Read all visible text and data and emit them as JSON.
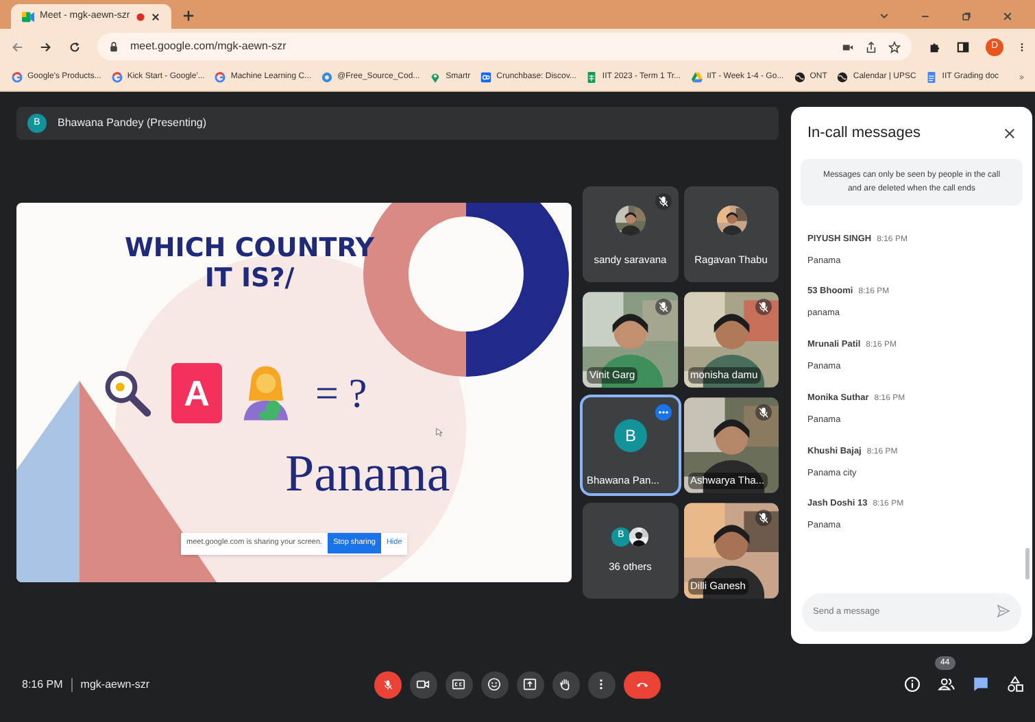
{
  "browser": {
    "tab": {
      "title": "Meet - mgk-aewn-szr",
      "recording": true
    },
    "address": "meet.google.com/mgk-aewn-szr",
    "profile_initial": "D",
    "bookmarks": [
      {
        "kind": "google",
        "label": "Google's Products..."
      },
      {
        "kind": "google",
        "label": "Kick Start - Google'..."
      },
      {
        "kind": "google",
        "label": "Machine Learning C..."
      },
      {
        "kind": "sync",
        "label": "@Free_Source_Cod..."
      },
      {
        "kind": "pin",
        "label": "Smartr"
      },
      {
        "kind": "crunchbase",
        "label": "Crunchbase: Discov..."
      },
      {
        "kind": "sheet",
        "label": "IIT 2023 - Term 1 Tr..."
      },
      {
        "kind": "drive",
        "label": "IIT - Week 1-4 - Go..."
      },
      {
        "kind": "globe",
        "label": "ONT"
      },
      {
        "kind": "globe",
        "label": "Calendar | UPSC"
      },
      {
        "kind": "doc",
        "label": "IIT Grading doc"
      }
    ]
  },
  "presenter": {
    "initial": "B",
    "label": "Bhawana Pandey (Presenting)"
  },
  "slide": {
    "title": "WHICH COUNTRY IT IS?/",
    "letter": "A",
    "equation": "= ?",
    "answer": "Panama",
    "share_bar": {
      "message": "meet.google.com is sharing your screen.",
      "button": "Stop sharing",
      "link": "Hide"
    }
  },
  "tiles": [
    {
      "kind": "avatar",
      "name": "sandy saravana",
      "muted": true,
      "highlighted": false
    },
    {
      "kind": "avatar",
      "name": "Ragavan Thabu",
      "muted": false,
      "highlighted": false
    },
    {
      "kind": "video",
      "name": "Vinit Garg",
      "muted": true,
      "highlighted": false
    },
    {
      "kind": "video",
      "name": "monisha damu",
      "muted": true,
      "highlighted": false
    },
    {
      "kind": "initial",
      "name": "Bhawana Pan...",
      "initial": "B",
      "muted": false,
      "highlighted": true
    },
    {
      "kind": "video",
      "name": "Ashwarya Tha...",
      "muted": true,
      "highlighted": false
    },
    {
      "kind": "others",
      "name": "36 others",
      "initial": "B",
      "muted": false,
      "highlighted": false
    },
    {
      "kind": "video",
      "name": "Dilli Ganesh",
      "muted": true,
      "highlighted": false
    }
  ],
  "chat": {
    "title": "In-call messages",
    "notice": "Messages can only be seen by people in the call and are deleted when the call ends",
    "messages": [
      {
        "sender": "PIYUSH SINGH",
        "time": "8:16 PM",
        "text": "Panama"
      },
      {
        "sender": "53 Bhoomi",
        "time": "8:16 PM",
        "text": "panama"
      },
      {
        "sender": "Mrunali Patil",
        "time": "8:16 PM",
        "text": "Panama"
      },
      {
        "sender": "Monika Suthar",
        "time": "8:16 PM",
        "text": "Panama"
      },
      {
        "sender": "Khushi Bajaj",
        "time": "8:16 PM",
        "text": "Panama city"
      },
      {
        "sender": "Jash Doshi 13",
        "time": "8:16 PM",
        "text": "Panama"
      }
    ],
    "placeholder": "Send a message"
  },
  "bottom_bar": {
    "time": "8:16 PM",
    "meeting_code": "mgk-aewn-szr",
    "mic": {
      "muted": true
    },
    "buttons": [
      {
        "kind": "camera"
      },
      {
        "kind": "captions"
      },
      {
        "kind": "emoji"
      },
      {
        "kind": "present"
      },
      {
        "kind": "hand"
      },
      {
        "kind": "more"
      }
    ],
    "panels": [
      {
        "kind": "info",
        "selected": false
      },
      {
        "kind": "people",
        "selected": false,
        "badge": "44"
      },
      {
        "kind": "chat",
        "selected": true
      },
      {
        "kind": "activities",
        "selected": false
      }
    ]
  }
}
